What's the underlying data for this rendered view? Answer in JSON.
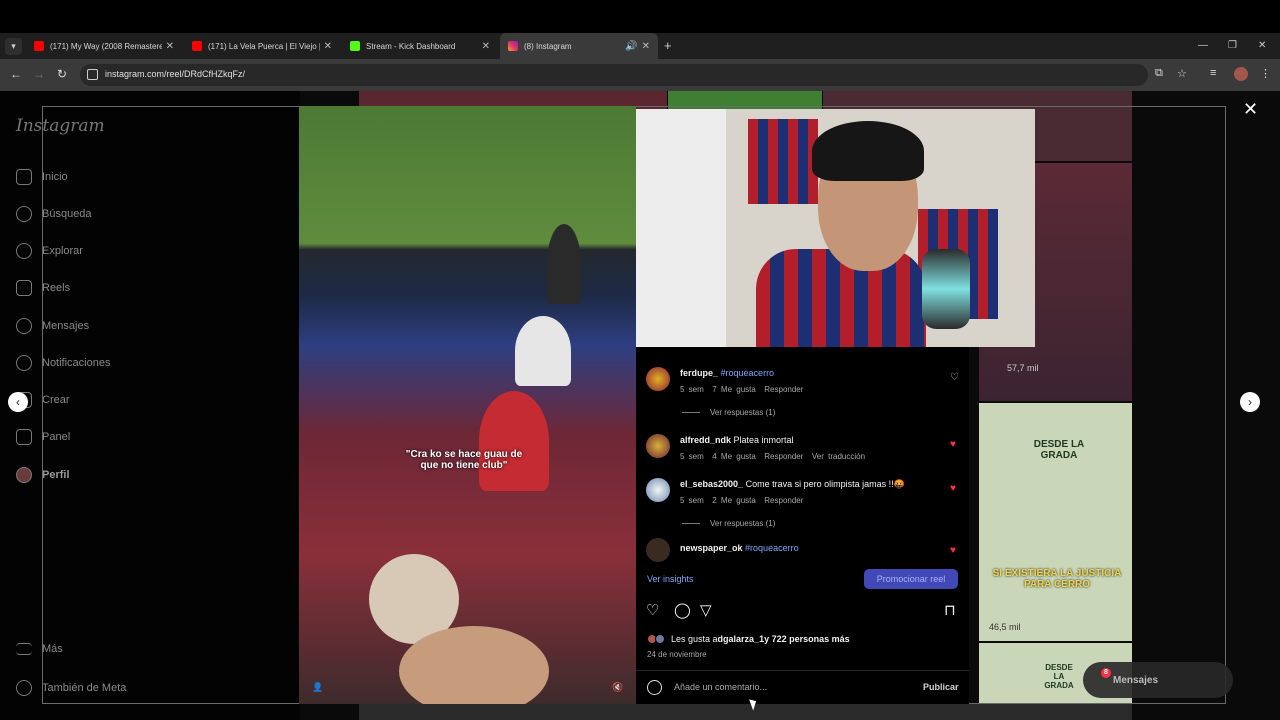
{
  "browser": {
    "tabs": [
      {
        "title": "(171) My Way (2008 Remastered)",
        "favicon": "youtube-icon",
        "color": "#ff0000"
      },
      {
        "title": "(171) La Vela Puerca | El Viejo | Er...",
        "favicon": "youtube-icon",
        "color": "#ff0000"
      },
      {
        "title": "Stream - Kick Dashboard",
        "favicon": "kick-icon",
        "color": "#53fc18"
      },
      {
        "title": "(8) Instagram",
        "favicon": "instagram-icon",
        "color": "#e1306c",
        "active": true
      }
    ],
    "url": "instagram.com/reel/DRdCfHZkqFz/"
  },
  "instagram": {
    "logo": "Instagram",
    "nav": [
      {
        "label": "Inicio",
        "icon": "home-icon"
      },
      {
        "label": "Búsqueda",
        "icon": "search-icon"
      },
      {
        "label": "Explorar",
        "icon": "compass-icon"
      },
      {
        "label": "Reels",
        "icon": "reels-icon"
      },
      {
        "label": "Mensajes",
        "icon": "messenger-icon"
      },
      {
        "label": "Notificaciones",
        "icon": "heart-icon"
      },
      {
        "label": "Crear",
        "icon": "plus-icon"
      },
      {
        "label": "Panel",
        "icon": "chart-icon"
      },
      {
        "label": "Perfil",
        "icon": "avatar-icon"
      }
    ],
    "bottom_nav": [
      {
        "label": "Más",
        "icon": "menu-icon"
      },
      {
        "label": "También de Meta",
        "icon": "meta-icon"
      }
    ],
    "reel": {
      "caption": "\"Cra ko se hace guau de que no tiene club\""
    },
    "comments": [
      {
        "user": "ferdupe_",
        "text": "#roqueacerro",
        "age": "5 sem",
        "likes": "7 Me gusta",
        "reply": "Responder",
        "replies": "Ver respuestas (1)",
        "liked": false
      },
      {
        "user": "alfredd_ndk",
        "text": "Platea inmortal",
        "age": "5 sem",
        "likes": "4 Me gusta",
        "reply": "Responder",
        "translate": "Ver traducción",
        "liked": true
      },
      {
        "user": "el_sebas2000_",
        "text": "Come trava si pero olimpista jamas !!🤬",
        "age": "5 sem",
        "likes": "2 Me gusta",
        "reply": "Responder",
        "replies": "Ver respuestas (1)",
        "liked": true
      },
      {
        "user": "newspaper_ok",
        "text": "#roqueacerro",
        "liked": true
      }
    ],
    "insights": "Ver insights",
    "promote": "Promocionar reel",
    "likes_prefix": "Les gusta a ",
    "likes_user": "dgalarza_1",
    "likes_suffix": " y 722 personas más",
    "date": "24 de noviembre",
    "comment_placeholder": "Añade un comentario...",
    "publish": "Publicar",
    "bg_views": [
      "57,7 mil",
      "46,5 mil"
    ],
    "bg_texts": [
      "DESDE LA GRADA",
      "SI EXISTIERA LA JUSTICIA PARA CERRO",
      "DESDE LA GRADA"
    ],
    "messages_pill": "Mensajes",
    "messages_badge": "8",
    "nav_badge": "8"
  },
  "colors": {
    "accent": "#4149b7",
    "link": "#7fa6ff",
    "heart": "#ff3040"
  }
}
